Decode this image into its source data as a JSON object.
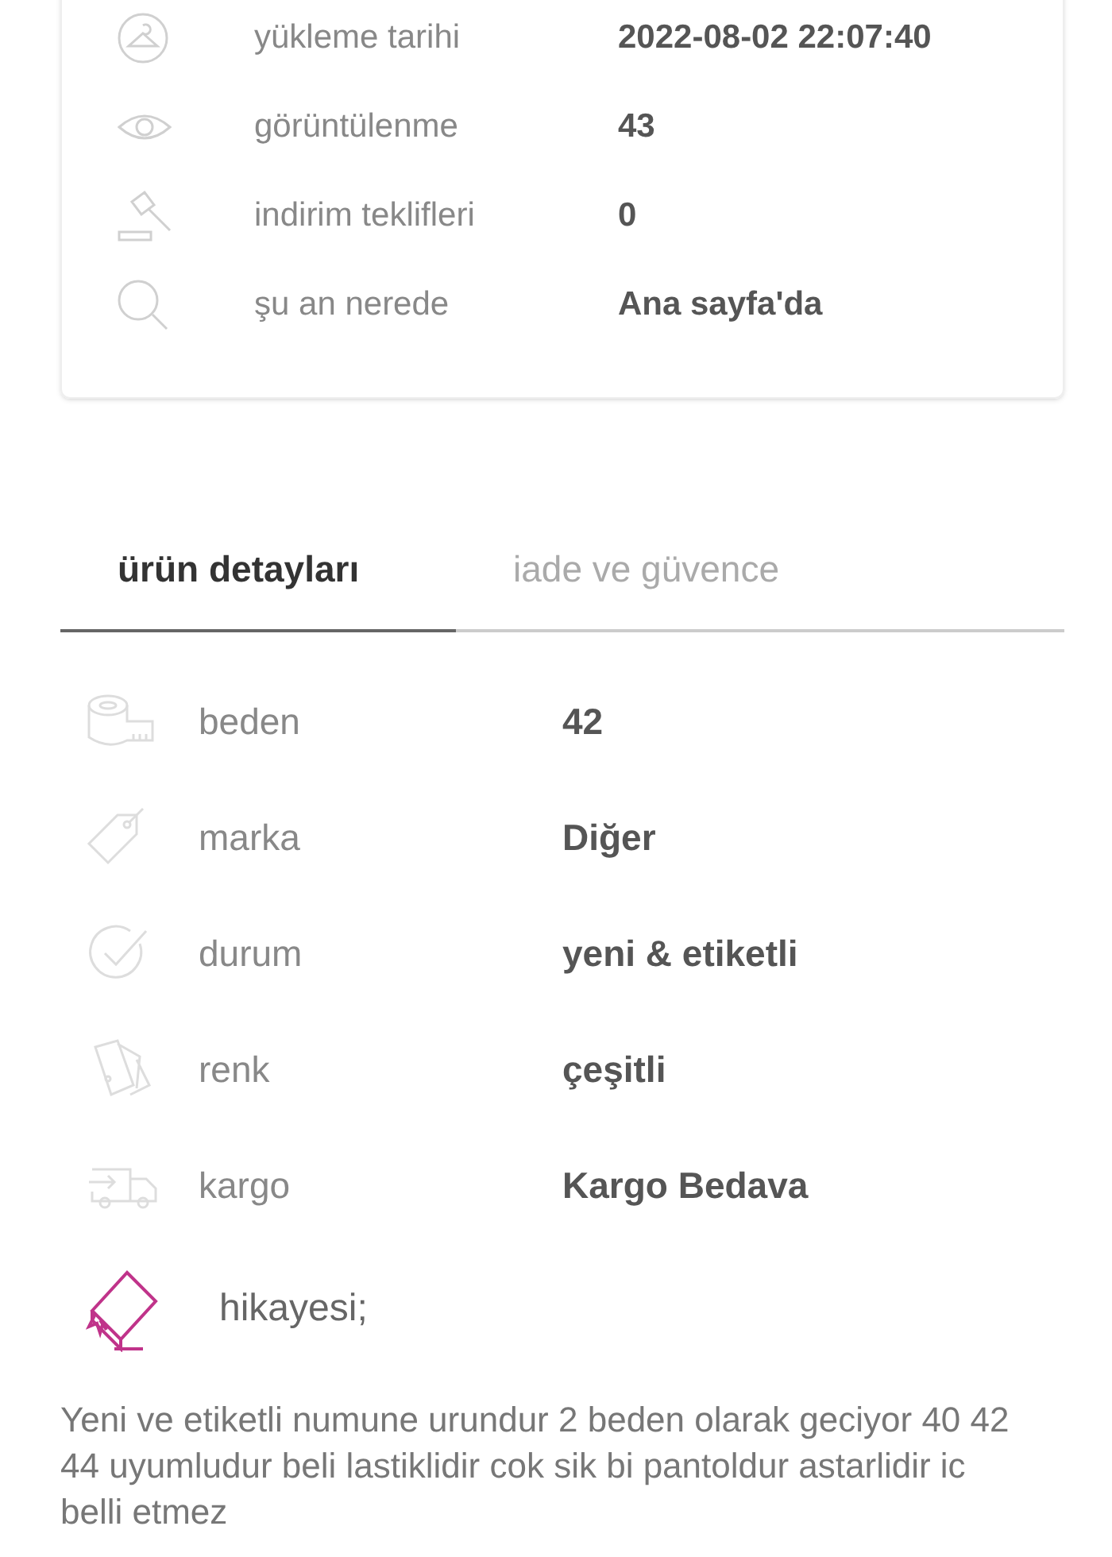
{
  "stats": [
    {
      "label": "yükleme tarihi",
      "value": "2022-08-02 22:07:40"
    },
    {
      "label": "görüntülenme",
      "value": "43"
    },
    {
      "label": "indirim teklifleri",
      "value": "0"
    },
    {
      "label": "şu an nerede",
      "value": "Ana sayfa'da"
    }
  ],
  "tabs": [
    {
      "label": "ürün detayları",
      "selected": true
    },
    {
      "label": "iade ve güvence",
      "selected": false
    }
  ],
  "details": [
    {
      "label": "beden",
      "value": "42"
    },
    {
      "label": "marka",
      "value": "Diğer"
    },
    {
      "label": "durum",
      "value": "yeni & etiketli"
    },
    {
      "label": "renk",
      "value": "çeşitli"
    },
    {
      "label": "kargo",
      "value": "Kargo Bedava"
    }
  ],
  "story": {
    "title": "hikayesi;",
    "text": "Yeni ve etiketli numune urundur 2 beden olarak geciyor 40 42 44 uyumludur beli lastiklidir cok sik bi pantoldur astarlidir ic belli etmez"
  }
}
